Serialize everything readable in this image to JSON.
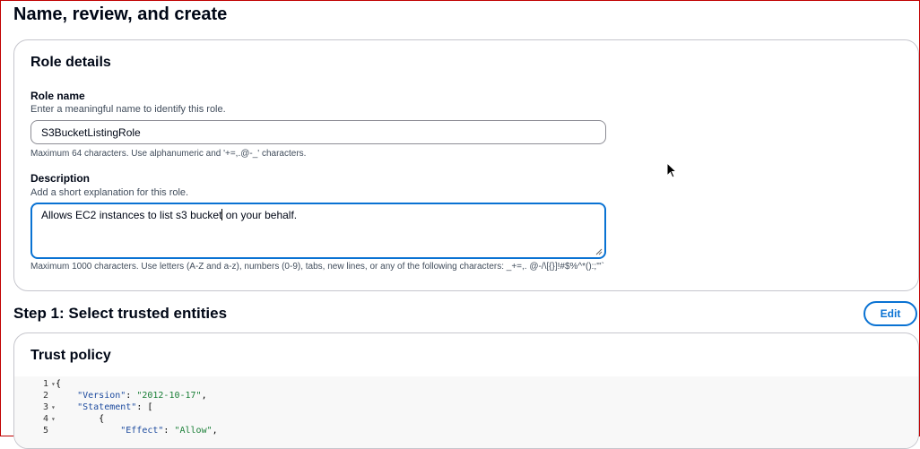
{
  "page": {
    "title": "Name, review, and create"
  },
  "role_details": {
    "title": "Role details",
    "role_name": {
      "label": "Role name",
      "description": "Enter a meaningful name to identify this role.",
      "value": "S3BucketListingRole",
      "hint": "Maximum 64 characters. Use alphanumeric and '+=,.@-_' characters."
    },
    "description_field": {
      "label": "Description",
      "description": "Add a short explanation for this role.",
      "value_before_caret": "Allows EC2 instances to list s3 bucket",
      "value_after_caret": " on your behalf.",
      "hint": "Maximum 1000 characters. Use letters (A-Z and a-z), numbers (0-9), tabs, new lines, or any of the following characters: _+=,. @-/\\[{}]!#$%^*():;\"'`"
    }
  },
  "step1": {
    "title": "Step 1: Select trusted entities",
    "edit_label": "Edit"
  },
  "trust_policy": {
    "title": "Trust policy",
    "lines": [
      {
        "num": "1",
        "fold": "▾",
        "indent": "",
        "key": "",
        "sep": "",
        "val": "",
        "punct": "{"
      },
      {
        "num": "2",
        "fold": "",
        "indent": "    ",
        "key": "\"Version\"",
        "sep": ": ",
        "val": "\"2012-10-17\"",
        "punct": ","
      },
      {
        "num": "3",
        "fold": "▾",
        "indent": "    ",
        "key": "\"Statement\"",
        "sep": ": ",
        "val": "",
        "punct": "["
      },
      {
        "num": "4",
        "fold": "▾",
        "indent": "        ",
        "key": "",
        "sep": "",
        "val": "",
        "punct": "{"
      },
      {
        "num": "5",
        "fold": "",
        "indent": "            ",
        "key": "\"Effect\"",
        "sep": ": ",
        "val": "\"Allow\"",
        "punct": ","
      }
    ]
  },
  "colors": {
    "accent": "#0972d3",
    "border": "#c6c6cd",
    "text": "#000716"
  }
}
